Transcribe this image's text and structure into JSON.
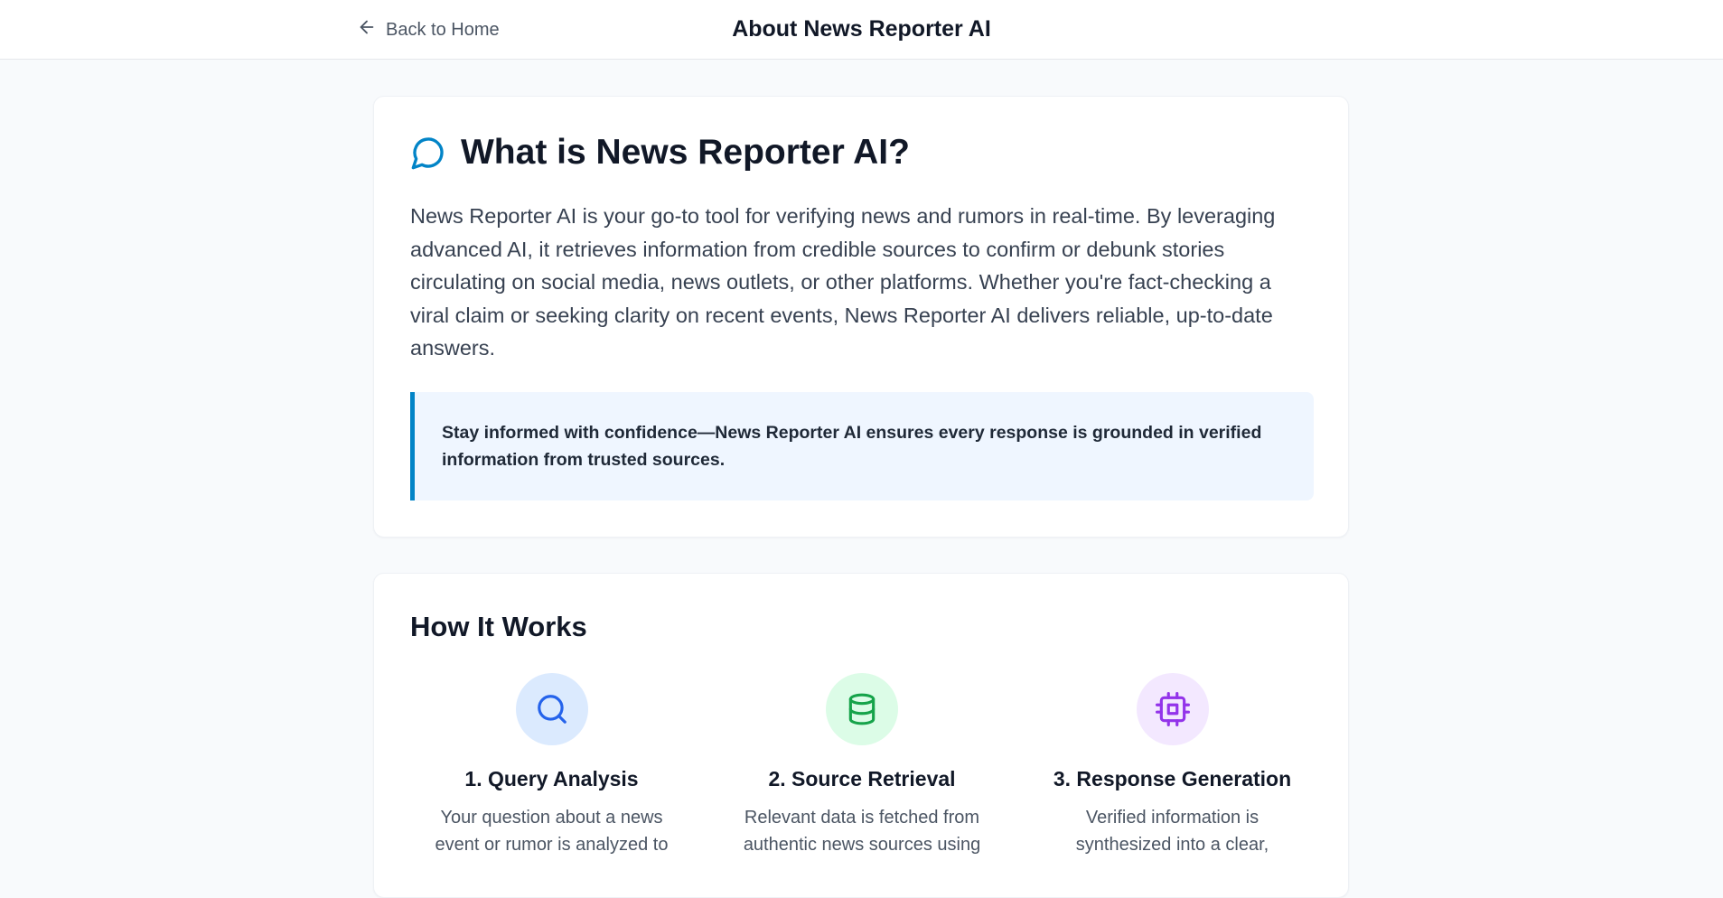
{
  "header": {
    "back_label": "Back to Home",
    "title": "About News Reporter AI"
  },
  "about": {
    "heading": "What is News Reporter AI?",
    "icon": "message-circle-icon",
    "description": "News Reporter AI is your go-to tool for verifying news and rumors in real-time. By leveraging advanced AI, it retrieves information from credible sources to confirm or debunk stories circulating on social media, news outlets, or other platforms. Whether you're fact-checking a viral claim or seeking clarity on recent events, News Reporter AI delivers reliable, up-to-date answers.",
    "callout": "Stay informed with confidence—News Reporter AI ensures every response is grounded in verified information from trusted sources."
  },
  "how_it_works": {
    "title": "How It Works",
    "steps": [
      {
        "icon": "search-icon",
        "color": "#2563eb",
        "title": "1. Query Analysis",
        "text": "Your question about a news event or rumor is analyzed to"
      },
      {
        "icon": "database-icon",
        "color": "#16a34a",
        "title": "2. Source Retrieval",
        "text": "Relevant data is fetched from authentic news sources using"
      },
      {
        "icon": "cpu-icon",
        "color": "#9333ea",
        "title": "3. Response Generation",
        "text": "Verified information is synthesized into a clear,"
      }
    ]
  },
  "colors": {
    "accent": "#0284c7",
    "page_background": "#f8fafc",
    "callout_background": "#eff6ff"
  }
}
